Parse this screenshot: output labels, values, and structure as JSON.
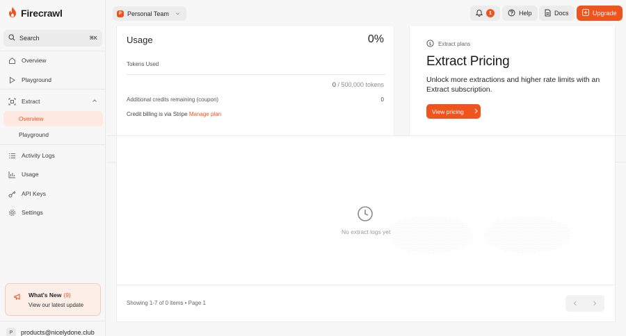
{
  "app": {
    "name": "Firecrawl"
  },
  "search": {
    "label": "Search",
    "shortcut": "⌘K"
  },
  "nav": {
    "overview": "Overview",
    "playground": "Playground",
    "extract": "Extract",
    "extract_overview": "Overview",
    "extract_playground": "Playground",
    "activity_logs": "Activity Logs",
    "usage": "Usage",
    "api_keys": "API Keys",
    "settings": "Settings"
  },
  "whats_new": {
    "title": "What's New",
    "count": "(9)",
    "subtitle": "View our latest update"
  },
  "user": {
    "initial": "P",
    "email": "products@nicelydone.club"
  },
  "header": {
    "team_initial": "P",
    "team_name": "Personal Team",
    "notification_count": "1",
    "help": "Help",
    "docs": "Docs",
    "upgrade": "Upgrade"
  },
  "usage": {
    "title": "Usage",
    "percent": "0%",
    "tokens_label": "Tokens Used",
    "tokens_used": "0",
    "tokens_total": "/ 500,000 tokens",
    "credits_label": "Additional credits remaining (coupon)",
    "credits_value": "0",
    "billing_text": "Credit billing is via Stripe ",
    "manage_plan": "Manage plan"
  },
  "pricing": {
    "tag": "Extract plans",
    "title": "Extract Pricing",
    "description": "Unlock more extractions and higher rate limits with an Extract subscription.",
    "button": "View pricing"
  },
  "logs": {
    "empty_text": "No extract logs yet",
    "showing": "Showing 1-7 of 0 items • Page 1"
  },
  "colors": {
    "accent": "#f0541e",
    "active_bg": "#fde9e1"
  }
}
